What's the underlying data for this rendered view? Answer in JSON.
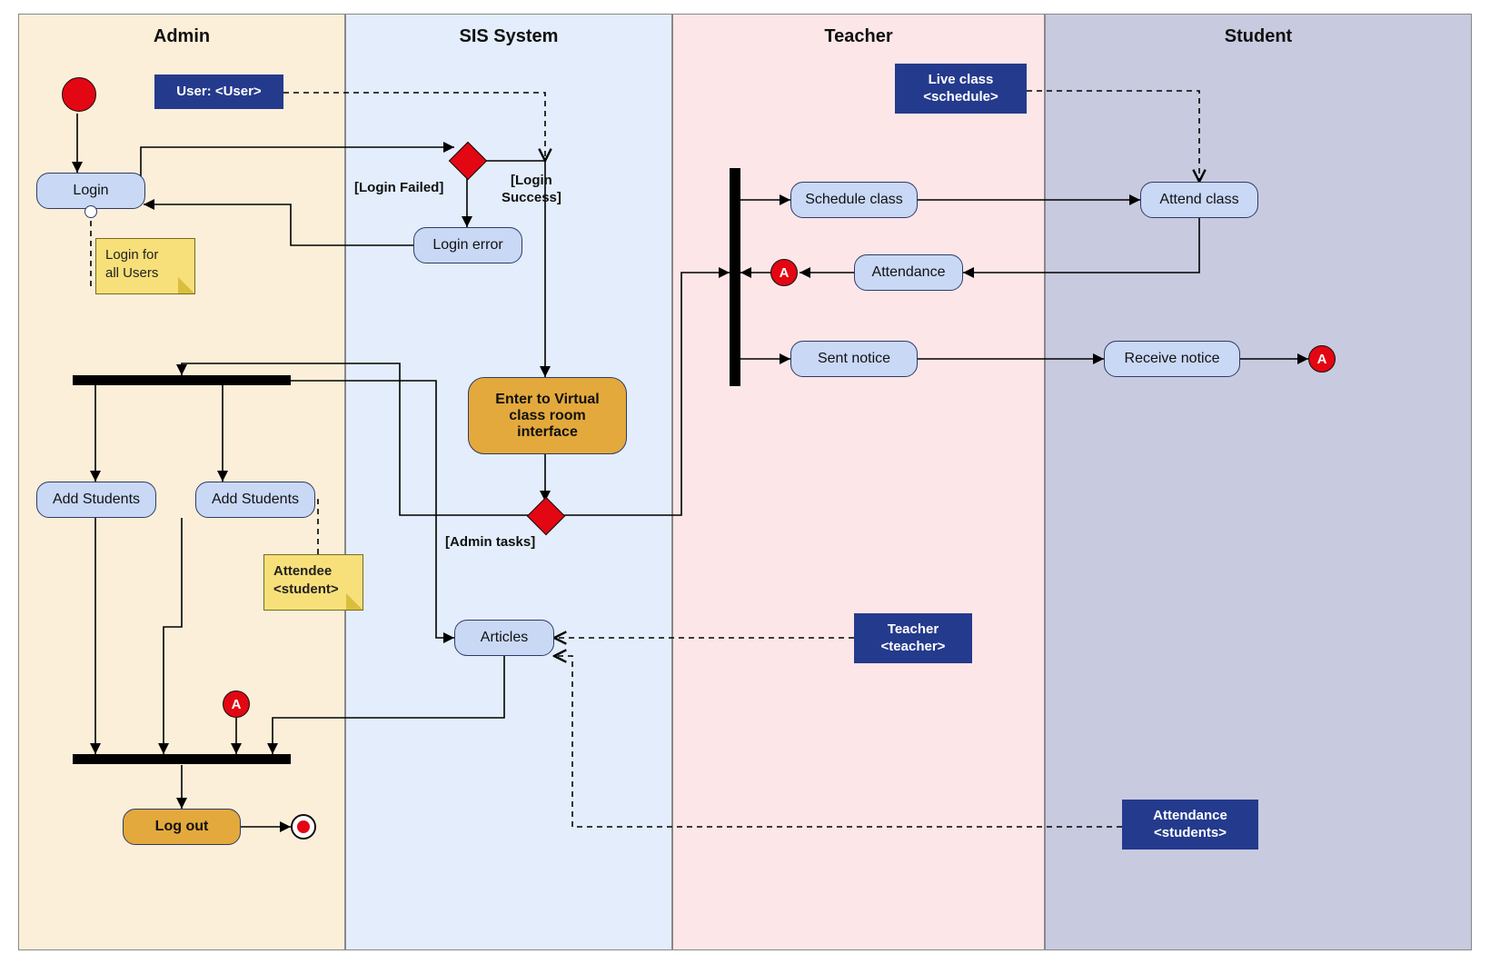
{
  "lanes": {
    "admin": {
      "title": "Admin"
    },
    "sis": {
      "title": "SIS System"
    },
    "teacher": {
      "title": "Teacher"
    },
    "student": {
      "title": "Student"
    }
  },
  "nodes": {
    "login": "Login",
    "login_error": "Login error",
    "enter_vcr": "Enter to Virtual class room interface",
    "add_students_1": "Add Students",
    "add_students_2": "Add Students",
    "articles": "Articles",
    "log_out": "Log out",
    "schedule_class": "Schedule class",
    "attendance": "Attendance",
    "sent_notice": "Sent notice",
    "attend_class": "Attend class",
    "receive_notice": "Receive notice"
  },
  "objects": {
    "user": "User: <User>",
    "live_class": "Live class\n<schedule>",
    "teacher": "Teacher\n<teacher>",
    "attendance": "Attendance\n<students>"
  },
  "notes": {
    "login_all": "Login for\nall Users",
    "attendee": "Attendee\n<student>"
  },
  "guards": {
    "login_failed": "[Login Failed]",
    "login_success": "[Login\nSuccess]",
    "admin_tasks": "[Admin tasks]"
  },
  "connector_label": "A",
  "colors": {
    "lane_admin": "#fcefd9",
    "lane_sis": "#e3edfb",
    "lane_teacher": "#fce6e8",
    "lane_student": "#c8cbdf",
    "activity": "#c9d8f5",
    "orange": "#e3a93c",
    "object": "#243a8d",
    "note": "#f7e07a",
    "red": "#e30613"
  },
  "chart_data": {
    "type": "uml-activity-diagram",
    "swimlanes": [
      "Admin",
      "SIS System",
      "Teacher",
      "Student"
    ],
    "initial": "InitialNode",
    "nodes": [
      {
        "id": "InitialNode",
        "type": "initial",
        "lane": "Admin"
      },
      {
        "id": "Login",
        "type": "activity",
        "lane": "Admin",
        "label": "Login"
      },
      {
        "id": "NoteLogin",
        "type": "note",
        "lane": "Admin",
        "label": "Login for all Users",
        "attached_to": "Login"
      },
      {
        "id": "UserObj",
        "type": "object",
        "lane": "Admin",
        "label": "User: <User>"
      },
      {
        "id": "Decision1",
        "type": "decision",
        "lane": "SIS System"
      },
      {
        "id": "LoginError",
        "type": "activity",
        "lane": "SIS System",
        "label": "Login error"
      },
      {
        "id": "EnterVCR",
        "type": "activity",
        "lane": "SIS System",
        "label": "Enter to Virtual class room interface",
        "highlight": true
      },
      {
        "id": "Decision2",
        "type": "decision",
        "lane": "SIS System"
      },
      {
        "id": "Fork1",
        "type": "fork",
        "lane": "Admin",
        "orientation": "horizontal"
      },
      {
        "id": "AddStudents1",
        "type": "activity",
        "lane": "Admin",
        "label": "Add Students"
      },
      {
        "id": "AddStudents2",
        "type": "activity",
        "lane": "Admin",
        "label": "Add Students"
      },
      {
        "id": "NoteAttendee",
        "type": "note",
        "lane": "Admin",
        "label": "Attendee <student>",
        "attached_to": "AddStudents2"
      },
      {
        "id": "ConnA_in",
        "type": "connector",
        "lane": "Admin",
        "label": "A"
      },
      {
        "id": "Join1",
        "type": "join",
        "lane": "Admin",
        "orientation": "horizontal"
      },
      {
        "id": "LogOut",
        "type": "activity",
        "lane": "Admin",
        "label": "Log out",
        "highlight": true
      },
      {
        "id": "Final",
        "type": "final",
        "lane": "Admin"
      },
      {
        "id": "Articles",
        "type": "activity",
        "lane": "SIS System",
        "label": "Articles"
      },
      {
        "id": "TeacherObj",
        "type": "object",
        "lane": "Teacher",
        "label": "Teacher <teacher>"
      },
      {
        "id": "AttendanceObj",
        "type": "object",
        "lane": "Student",
        "label": "Attendance <students>"
      },
      {
        "id": "LiveClassObj",
        "type": "object",
        "lane": "Teacher",
        "label": "Live class <schedule>"
      },
      {
        "id": "Fork2",
        "type": "fork",
        "lane": "Teacher",
        "orientation": "vertical"
      },
      {
        "id": "ScheduleClass",
        "type": "activity",
        "lane": "Teacher",
        "label": "Schedule class"
      },
      {
        "id": "AttendClass",
        "type": "activity",
        "lane": "Student",
        "label": "Attend class"
      },
      {
        "id": "Attendance",
        "type": "activity",
        "lane": "Teacher",
        "label": "Attendance"
      },
      {
        "id": "ConnA_out1",
        "type": "connector",
        "lane": "Teacher",
        "label": "A"
      },
      {
        "id": "SentNotice",
        "type": "activity",
        "lane": "Teacher",
        "label": "Sent notice"
      },
      {
        "id": "ReceiveNotice",
        "type": "activity",
        "lane": "Student",
        "label": "Receive notice"
      },
      {
        "id": "ConnA_out2",
        "type": "connector",
        "lane": "Student",
        "label": "A"
      }
    ],
    "edges": [
      {
        "from": "InitialNode",
        "to": "Login"
      },
      {
        "from": "Login",
        "to": "Decision1"
      },
      {
        "from": "Decision1",
        "to": "LoginError",
        "guard": "[Login Failed]"
      },
      {
        "from": "LoginError",
        "to": "Login"
      },
      {
        "from": "Decision1",
        "to": "EnterVCR",
        "guard": "[Login Success]"
      },
      {
        "from": "UserObj",
        "to": "EnterVCR",
        "style": "dashed"
      },
      {
        "from": "EnterVCR",
        "to": "Decision2"
      },
      {
        "from": "Decision2",
        "to": "Fork1",
        "guard": "[Admin tasks]"
      },
      {
        "from": "Decision2",
        "to": "Fork2"
      },
      {
        "from": "Fork1",
        "to": "AddStudents1"
      },
      {
        "from": "Fork1",
        "to": "AddStudents2"
      },
      {
        "from": "Fork1",
        "to": "Articles"
      },
      {
        "from": "AddStudents1",
        "to": "Join1"
      },
      {
        "from": "AddStudents2",
        "to": "Join1"
      },
      {
        "from": "ConnA_in",
        "to": "Join1"
      },
      {
        "from": "Articles",
        "to": "Join1"
      },
      {
        "from": "Join1",
        "to": "LogOut"
      },
      {
        "from": "LogOut",
        "to": "Final"
      },
      {
        "from": "TeacherObj",
        "to": "Articles",
        "style": "dashed"
      },
      {
        "from": "AttendanceObj",
        "to": "Articles",
        "style": "dashed"
      },
      {
        "from": "LiveClassObj",
        "to": "AttendClass",
        "style": "dashed"
      },
      {
        "from": "Fork2",
        "to": "ScheduleClass"
      },
      {
        "from": "ScheduleClass",
        "to": "AttendClass"
      },
      {
        "from": "AttendClass",
        "to": "Attendance"
      },
      {
        "from": "Attendance",
        "to": "ConnA_out1"
      },
      {
        "from": "Fork2",
        "to": "SentNotice"
      },
      {
        "from": "SentNotice",
        "to": "ReceiveNotice"
      },
      {
        "from": "ReceiveNotice",
        "to": "ConnA_out2"
      }
    ]
  }
}
